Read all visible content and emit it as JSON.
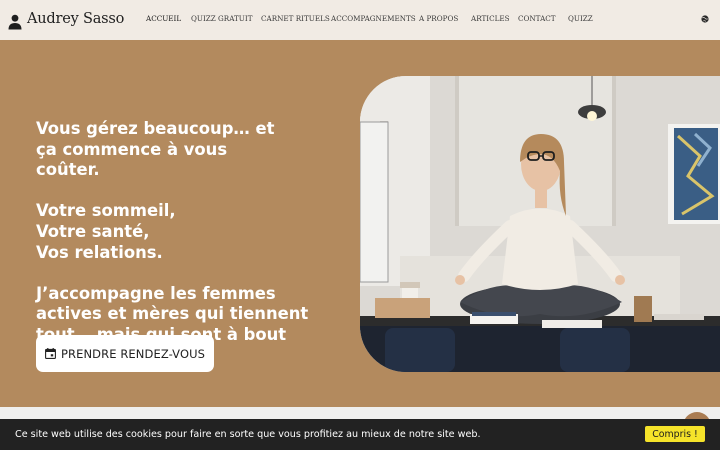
{
  "brand": {
    "name": "Audrey Sasso",
    "icon": "person-icon"
  },
  "nav": {
    "items": [
      {
        "label": "ACCUEIL",
        "active": true
      },
      {
        "label": "QUIZZ GRATUIT"
      },
      {
        "label": "CARNET RITUELS"
      },
      {
        "label": "ACCOMPAGNEMENTS"
      },
      {
        "label": "A PROPOS"
      },
      {
        "label": "ARTICLES"
      },
      {
        "label": "CONTACT"
      },
      {
        "label": "QUIZZ"
      }
    ],
    "language_icon": "globe-icon"
  },
  "hero": {
    "paragraphs": [
      "Vous gérez beaucoup… et ça commence à vous coûter.",
      "Votre sommeil,\nVotre santé,\nVos relations.",
      "J’accompagne les femmes actives et mères qui tiennent tout… mais qui sont à bout intérieurement."
    ],
    "cta_label": "PRENDRE RENDEZ-VOUS",
    "cta_icon": "calendar-icon"
  },
  "cookie_banner": {
    "text": "Ce site web utilise des cookies pour faire en sorte que vous profitiez au mieux de notre site web.",
    "button_label": "Compris !"
  },
  "colors": {
    "hero_background": "#b38a5e",
    "header_background": "#f1ebe4",
    "cookie_background": "#222222",
    "cookie_button": "#f5e32a"
  }
}
